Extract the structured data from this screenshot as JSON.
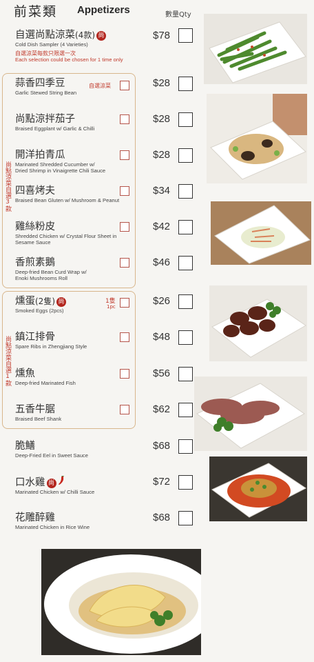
{
  "header": {
    "title_zh": "前菜類",
    "title_en": "Appetizers",
    "qty_label": "數量Qty"
  },
  "items": [
    {
      "zh": "自選尚點涼菜",
      "zh_extra": "(4款)",
      "badge": "尚",
      "en": "Cold Dish Sampler (4 Varieties)",
      "price": "$78",
      "note_zh": "自選涼菜每款只限選一次",
      "note_en": "Each selection could be chosen for 1 time only"
    },
    {
      "zh": "蒜香四季豆",
      "en": "Garlic Stewed String Bean",
      "price": "$28",
      "tag": "自選涼菜"
    },
    {
      "zh": "尚點涼拌茄子",
      "en": "Braised Eggplant w/ Garlic & Chilli",
      "price": "$28"
    },
    {
      "zh": "開洋拍青瓜",
      "en": "Marinated Shredded Cucumber w/",
      "en2": "Dried Shrimp in Vinaigrette Chili Sauce",
      "price": "$28"
    },
    {
      "zh": "四喜烤夫",
      "en": "Braised Bean Gluten w/ Mushroom &  Peanut",
      "price": "$34"
    },
    {
      "zh": "雞絲粉皮",
      "en": "Shredded Chicken w/ Crystal Flour Sheet in",
      "en2": "Sesame Sauce",
      "price": "$42"
    },
    {
      "zh": "香煎素鵝",
      "en": "Deep-fried Bean Curd Wrap w/",
      "en2": "Enoki Mushrooms Roll",
      "price": "$46"
    },
    {
      "zh": "燻蛋",
      "zh_extra": "(2隻)",
      "badge": "尚",
      "en": "Smoked Eggs (2pcs)",
      "price": "$26",
      "tag": "1隻",
      "tag2": "1pc"
    },
    {
      "zh": "鎮江排骨",
      "en": "Spare Ribs in Zhengjiang Style",
      "price": "$48"
    },
    {
      "zh": "燻魚",
      "en": "Deep-fried Marinated Fish",
      "price": "$56"
    },
    {
      "zh": "五香牛腒",
      "en": "Braised Beef Shank",
      "price": "$62"
    },
    {
      "zh": "脆鱔",
      "en": "Deep-Fried Eel in Sweet Sauce",
      "price": "$68"
    },
    {
      "zh": "口水雞",
      "badge": "尚",
      "chili": "chili-icon",
      "en": "Marinated Chicken w/ Chilli Sauce",
      "price": "$72"
    },
    {
      "zh": "花雕醉雞",
      "en": "Marinated Chicken in Rice Wine",
      "price": "$68"
    }
  ],
  "groups": {
    "group1_label": "尚點涼菜自選3款",
    "group2_label": "尚點涼菜自選1款"
  },
  "colors": {
    "accent_red": "#b3261e",
    "group_border": "#d8b68c"
  },
  "photos": [
    "green-beans-photo",
    "tofu-mushroom-photo",
    "cucumber-shrimp-photo",
    "spare-ribs-photo",
    "beef-shank-photo",
    "chili-chicken-photo",
    "drunken-chicken-photo"
  ]
}
